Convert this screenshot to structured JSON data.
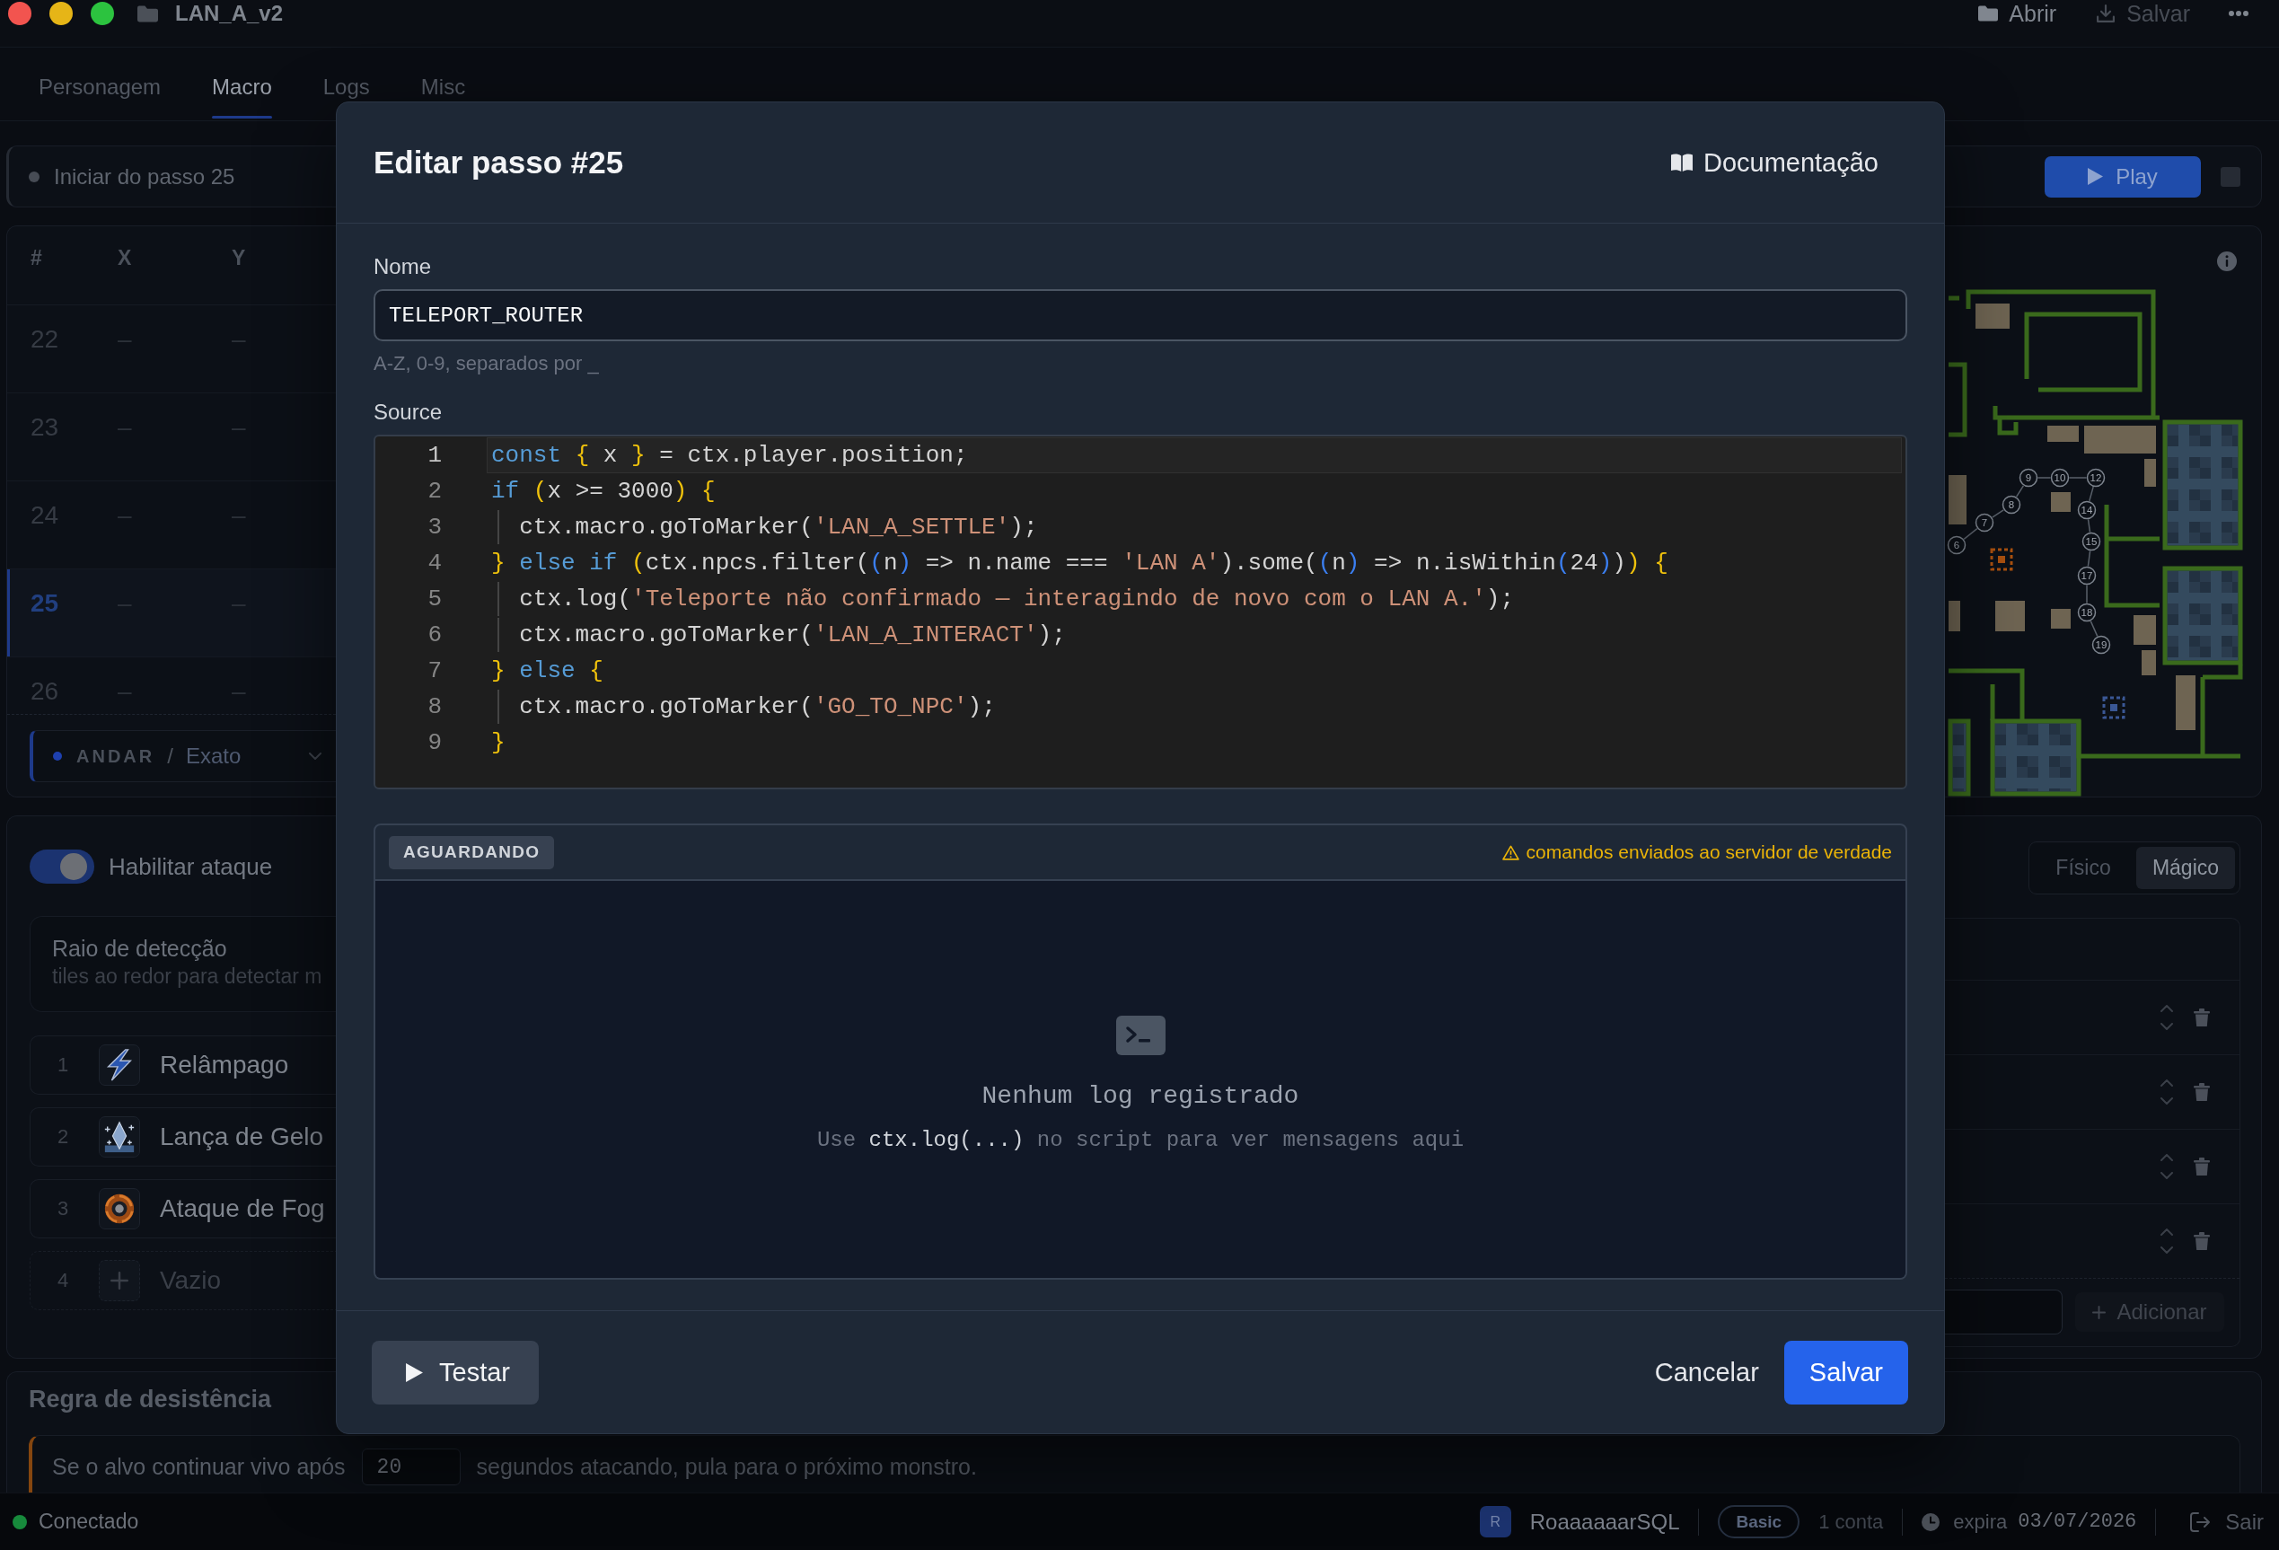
{
  "window": {
    "title": "LAN_A_v2",
    "actions": [
      {
        "kind": "open",
        "label": "Abrir",
        "disabled": false
      },
      {
        "kind": "save",
        "label": "Salvar",
        "disabled": true
      }
    ]
  },
  "tabs": [
    {
      "label": "Personagem",
      "selected": false
    },
    {
      "label": "Macro",
      "selected": true
    },
    {
      "label": "Logs",
      "selected": false
    },
    {
      "label": "Misc",
      "selected": false
    }
  ],
  "start_bar": {
    "label": "Iniciar do passo 25"
  },
  "playback": {
    "play_label": "Play"
  },
  "steps_table": {
    "columns": [
      "#",
      "X",
      "Y"
    ],
    "rows": [
      {
        "number": "22",
        "x": "–",
        "y": "–",
        "selected": false
      },
      {
        "number": "23",
        "x": "–",
        "y": "–",
        "selected": false
      },
      {
        "number": "24",
        "x": "–",
        "y": "–",
        "selected": false
      },
      {
        "number": "25",
        "x": "–",
        "y": "–",
        "selected": true
      },
      {
        "number": "26",
        "x": "–",
        "y": "–",
        "selected": false
      }
    ],
    "step_type": {
      "type": "ANDAR",
      "separator": "/",
      "mode": "Exato"
    }
  },
  "map": {
    "waypoints": [
      {
        "label": "6"
      },
      {
        "label": "7"
      },
      {
        "label": "8"
      },
      {
        "label": "9"
      },
      {
        "label": "10"
      },
      {
        "label": "12"
      },
      {
        "label": "14"
      },
      {
        "label": "15"
      },
      {
        "label": "17"
      },
      {
        "label": "18"
      },
      {
        "label": "19"
      }
    ]
  },
  "attack": {
    "toggle_label": "Habilitar ataque",
    "enabled": true,
    "radius": {
      "label": "Raio de detecção",
      "hint": "tiles ao redor para detectar m"
    },
    "spells": [
      {
        "number": "1",
        "name": "Relâmpago",
        "kind": "lightning"
      },
      {
        "number": "2",
        "name": "Lança de Gelo",
        "kind": "ice"
      },
      {
        "number": "3",
        "name": "Ataque de Fog",
        "kind": "fire"
      },
      {
        "number": "4",
        "name": "Vazio",
        "kind": "empty"
      }
    ],
    "damage_types": [
      {
        "label": "Físico",
        "selected": false
      },
      {
        "label": "Mágico",
        "selected": true
      }
    ],
    "skill_rows": [
      {
        "kind": "skill"
      },
      {
        "kind": "skill"
      },
      {
        "kind": "skill"
      },
      {
        "kind": "skill"
      }
    ],
    "add_label": "Adicionar"
  },
  "quit_rule": {
    "title": "Regra de desistência",
    "text_before": "Se o alvo continuar vivo após",
    "seconds": "20",
    "text_after": "segundos atacando, pula para o próximo monstro."
  },
  "dialog": {
    "title": "Editar passo #25",
    "docs_label": "Documentação",
    "name_label": "Nome",
    "name_value": "TELEPORT_ROUTER",
    "name_hint": "A-Z, 0-9, separados por _",
    "source_label": "Source",
    "code_lines": [
      {
        "number": "1",
        "current": true,
        "indent_guide": false,
        "tokens": [
          {
            "kind": "keyword",
            "text": "const "
          },
          {
            "kind": "bracket1",
            "text": "{"
          },
          {
            "kind": "plain",
            "text": " x "
          },
          {
            "kind": "bracket1",
            "text": "}"
          },
          {
            "kind": "plain",
            "text": " = ctx.player.position;"
          }
        ]
      },
      {
        "number": "2",
        "current": false,
        "indent_guide": false,
        "tokens": [
          {
            "kind": "keyword",
            "text": "if "
          },
          {
            "kind": "bracket1",
            "text": "("
          },
          {
            "kind": "plain",
            "text": "x >= 3000"
          },
          {
            "kind": "bracket1",
            "text": ") {"
          }
        ]
      },
      {
        "number": "3",
        "current": false,
        "indent_guide": true,
        "tokens": [
          {
            "kind": "plain",
            "text": "ctx.macro.goToMarker"
          },
          {
            "kind": "bracket2",
            "text": "("
          },
          {
            "kind": "string",
            "text": "'LAN_A_SETTLE'"
          },
          {
            "kind": "bracket2",
            "text": ")"
          },
          {
            "kind": "plain",
            "text": ";"
          }
        ]
      },
      {
        "number": "4",
        "current": false,
        "indent_guide": false,
        "tokens": [
          {
            "kind": "bracket1",
            "text": "}"
          },
          {
            "kind": "keyword",
            "text": " else if "
          },
          {
            "kind": "bracket1",
            "text": "("
          },
          {
            "kind": "plain",
            "text": "ctx.npcs.filter"
          },
          {
            "kind": "bracket2",
            "text": "("
          },
          {
            "kind": "bracket3",
            "text": "("
          },
          {
            "kind": "plain",
            "text": "n"
          },
          {
            "kind": "bracket3",
            "text": ")"
          },
          {
            "kind": "plain",
            "text": " => n.name === "
          },
          {
            "kind": "string",
            "text": "'LAN A'"
          },
          {
            "kind": "bracket2",
            "text": ")"
          },
          {
            "kind": "plain",
            "text": ".some"
          },
          {
            "kind": "bracket2",
            "text": "("
          },
          {
            "kind": "bracket3",
            "text": "("
          },
          {
            "kind": "plain",
            "text": "n"
          },
          {
            "kind": "bracket3",
            "text": ")"
          },
          {
            "kind": "plain",
            "text": " => n.isWithin"
          },
          {
            "kind": "bracket3",
            "text": "("
          },
          {
            "kind": "plain",
            "text": "24"
          },
          {
            "kind": "bracket3",
            "text": ")"
          },
          {
            "kind": "bracket2",
            "text": ")"
          },
          {
            "kind": "bracket1",
            "text": ") {"
          }
        ]
      },
      {
        "number": "5",
        "current": false,
        "indent_guide": true,
        "tokens": [
          {
            "kind": "plain",
            "text": "ctx.log"
          },
          {
            "kind": "bracket2",
            "text": "("
          },
          {
            "kind": "string",
            "text": "'Teleporte não confirmado — interagindo de novo com o LAN A.'"
          },
          {
            "kind": "bracket2",
            "text": ")"
          },
          {
            "kind": "plain",
            "text": ";"
          }
        ]
      },
      {
        "number": "6",
        "current": false,
        "indent_guide": true,
        "tokens": [
          {
            "kind": "plain",
            "text": "ctx.macro.goToMarker"
          },
          {
            "kind": "bracket2",
            "text": "("
          },
          {
            "kind": "string",
            "text": "'LAN_A_INTERACT'"
          },
          {
            "kind": "bracket2",
            "text": ")"
          },
          {
            "kind": "plain",
            "text": ";"
          }
        ]
      },
      {
        "number": "7",
        "current": false,
        "indent_guide": false,
        "tokens": [
          {
            "kind": "bracket1",
            "text": "}"
          },
          {
            "kind": "keyword",
            "text": " else "
          },
          {
            "kind": "bracket1",
            "text": "{"
          }
        ]
      },
      {
        "number": "8",
        "current": false,
        "indent_guide": true,
        "tokens": [
          {
            "kind": "plain",
            "text": "ctx.macro.goToMarker"
          },
          {
            "kind": "bracket2",
            "text": "("
          },
          {
            "kind": "string",
            "text": "'GO_TO_NPC'"
          },
          {
            "kind": "bracket2",
            "text": ")"
          },
          {
            "kind": "plain",
            "text": ";"
          }
        ]
      },
      {
        "number": "9",
        "current": false,
        "indent_guide": false,
        "tokens": [
          {
            "kind": "bracket1",
            "text": "}"
          }
        ]
      }
    ],
    "log": {
      "status": "AGUARDANDO",
      "warning": "comandos enviados ao servidor de verdade",
      "empty_title": "Nenhum log registrado",
      "empty_hint": "Use **ctx.log(...)** no script para ver mensagens aqui"
    },
    "actions": [
      {
        "kind": "test",
        "label": "Testar"
      },
      {
        "kind": "cancel",
        "label": "Cancelar"
      },
      {
        "kind": "save",
        "label": "Salvar"
      }
    ]
  },
  "status_bar": {
    "connection": "Conectado",
    "connected": true,
    "avatar_initial": "R",
    "user": "RoaaaaaarSQL",
    "plan": "Basic",
    "accounts": "1 conta",
    "expires_label": "expira",
    "expires_date": "03/07/2026",
    "logout": "Sair"
  }
}
